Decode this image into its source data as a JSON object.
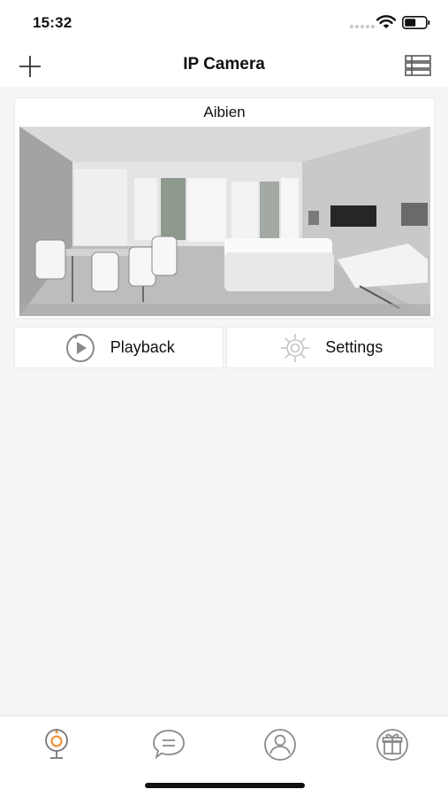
{
  "status_bar": {
    "time": "15:32"
  },
  "nav": {
    "title": "IP Camera",
    "add_icon": "plus-icon",
    "list_icon": "list-view-icon"
  },
  "camera": {
    "name": "Aibien",
    "preview": "living-room-snapshot"
  },
  "actions": [
    {
      "label": "Playback",
      "icon": "playback-icon"
    },
    {
      "label": "Settings",
      "icon": "gear-icon"
    }
  ],
  "tabs": [
    {
      "icon": "camera-icon",
      "active": true
    },
    {
      "icon": "message-icon",
      "active": false
    },
    {
      "icon": "user-icon",
      "active": false
    },
    {
      "icon": "gift-icon",
      "active": false
    }
  ],
  "colors": {
    "accent": "#f08a2c",
    "icon_gray": "#8a8a8a"
  }
}
